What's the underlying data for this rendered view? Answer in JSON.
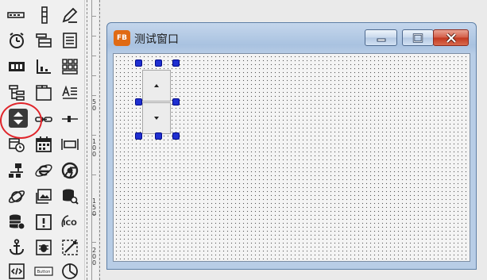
{
  "toolbox": {
    "tools": [
      "toolbar-icon",
      "splitter-icon",
      "edit-pen-icon",
      "timer-icon",
      "datagrid-icon",
      "listbox-icon",
      "imagebox-icon",
      "chart-icon",
      "grid-icon",
      "treeview-icon",
      "tabstrip-icon",
      "richtext-icon",
      "spin-control-icon",
      "hyperlink-icon",
      "slider-icon",
      "date-timer-icon",
      "calendar-icon",
      "ruler-icon",
      "network-icon",
      "ie-browser-icon",
      "chrome-browser-icon",
      "planet-icon",
      "image-gallery-icon",
      "database-search-icon",
      "database-icon",
      "alert-icon",
      "ico-icon",
      "anchor-icon",
      "bug-icon",
      "draw-icon",
      "code-icon",
      "button-icon",
      "pie-icon"
    ],
    "button_icon_text": "Button",
    "ico_text": "ICO"
  },
  "ruler": {
    "labels": [
      "5 0",
      "1 0 0",
      "1 5 0",
      "2 0 0"
    ]
  },
  "form": {
    "title": "测试窗口",
    "app_icon_text": "FB"
  },
  "colors": {
    "selection_handle": "#1f2fd0",
    "highlight_circle": "#e0252b",
    "close_button": "#c2371f"
  }
}
